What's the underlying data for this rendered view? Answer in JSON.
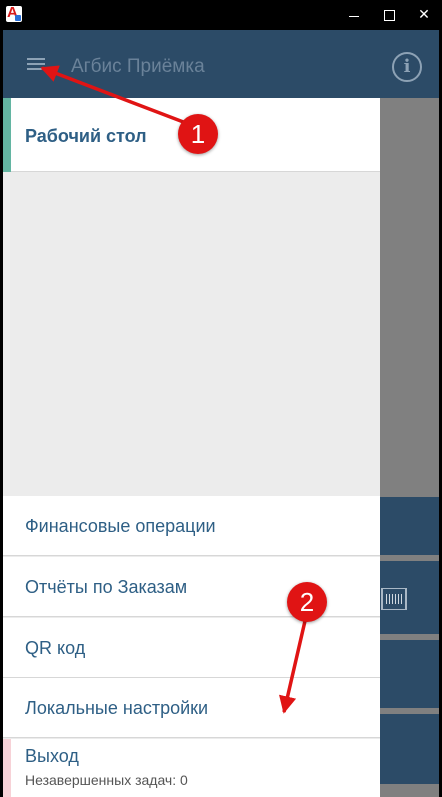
{
  "window": {
    "app_icon": "app-logo-icon",
    "controls": [
      "minimize-icon",
      "maximize-icon",
      "close-icon"
    ]
  },
  "appbar": {
    "title": "Агбис Приёмка",
    "menu_icon": "hamburger-icon",
    "info_icon": "info-icon",
    "info_glyph": "i"
  },
  "drawer": {
    "items": [
      {
        "label": "Рабочий стол",
        "active": true
      },
      {
        "label": "Финансовые операции"
      },
      {
        "label": "Отчёты по Заказам"
      },
      {
        "label": "QR код"
      },
      {
        "label": "Локальные настройки"
      },
      {
        "label": "Выход",
        "sub": "Незавершенных задач: 0"
      }
    ]
  },
  "annotations": {
    "markers": [
      "1",
      "2"
    ]
  },
  "colors": {
    "appbar": "#2c4b67",
    "accent_active": "#63b5a2",
    "accent_exit": "#f7d2d7",
    "nav_text": "#2e5f85",
    "annotation": "#e01414"
  }
}
